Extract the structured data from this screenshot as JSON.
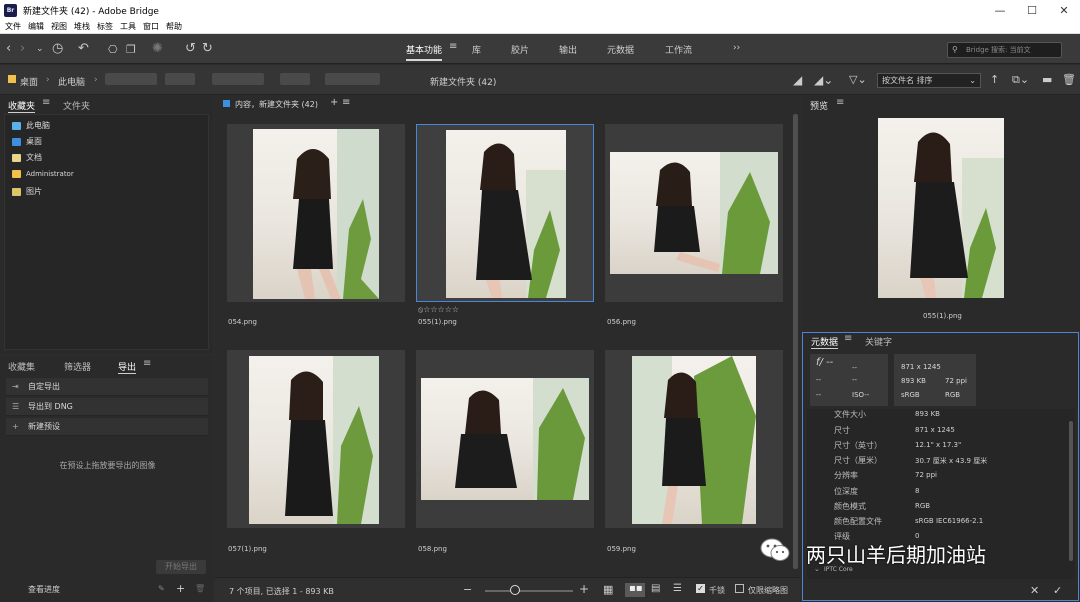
{
  "titlebar": {
    "logo": "Br",
    "title": "新建文件夹 (42) - Adobe Bridge",
    "minimize": "—",
    "maximize": "☐",
    "close": "✕"
  },
  "menu": [
    "文件",
    "编辑",
    "视图",
    "堆栈",
    "标签",
    "工具",
    "窗口",
    "帮助"
  ],
  "workspaces": [
    "基本功能",
    "库",
    "胶片",
    "输出",
    "元数据",
    "工作流"
  ],
  "workspace_more": "››",
  "search": {
    "placeholder": "Bridge 搜索: 当前文"
  },
  "path": {
    "items": [
      "桌面",
      "此电脑"
    ],
    "current_folder": "新建文件夹 (42)",
    "sort": "按文件名 排序"
  },
  "favorites": {
    "tab_active": "收藏夹",
    "tab_other": "文件夹",
    "items": [
      {
        "label": "此电脑",
        "icon": "computer-icon"
      },
      {
        "label": "桌面",
        "icon": "desktop-icon"
      },
      {
        "label": "文档",
        "icon": "document-icon"
      },
      {
        "label": "Administrator",
        "icon": "user-folder-icon"
      },
      {
        "label": "图片",
        "icon": "pictures-icon"
      }
    ]
  },
  "export_panel": {
    "tabs": [
      "收藏集",
      "筛选器",
      "导出"
    ],
    "rows": [
      "自定导出",
      "导出到 DNG",
      "新建预设"
    ],
    "hint": "在预设上拖放要导出的图像",
    "start_button": "开始导出",
    "progress_label": "查看进度"
  },
  "content": {
    "header": "内容，新建文件夹 (42)",
    "thumbnails": [
      {
        "name": "054.png",
        "orientation": "portrait",
        "selected": false
      },
      {
        "name": "055(1).png",
        "orientation": "portrait",
        "selected": true,
        "rating": "⦸☆☆☆☆☆"
      },
      {
        "name": "056.png",
        "orientation": "landscape",
        "selected": false
      },
      {
        "name": "057(1).png",
        "orientation": "portrait",
        "selected": false
      },
      {
        "name": "058.png",
        "orientation": "landscape",
        "selected": false
      },
      {
        "name": "059.png",
        "orientation": "portrait",
        "selected": false
      }
    ]
  },
  "preview": {
    "tab": "预览",
    "filename": "055(1).png"
  },
  "metadata": {
    "tab_active": "元数据",
    "tab_other": "关键字",
    "exif": {
      "f_stop": "f/ --",
      "dash1": "--",
      "dash2": "--",
      "dash3": "--",
      "dash4": "--",
      "iso": "ISO--",
      "dimensions": "871 x 1245",
      "size": "893 KB",
      "ppi": "72 ppi",
      "color1": "sRGB",
      "color2": "RGB"
    },
    "rows": [
      {
        "key": "文件大小",
        "value": "893 KB"
      },
      {
        "key": "尺寸",
        "value": "871 x 1245"
      },
      {
        "key": "尺寸（英寸）",
        "value": "12.1\" x 17.3\""
      },
      {
        "key": "尺寸（厘米）",
        "value": "30.7 厘米 x 43.9 厘米"
      },
      {
        "key": "分辨率",
        "value": "72 ppi"
      },
      {
        "key": "位深度",
        "value": "8"
      },
      {
        "key": "颜色模式",
        "value": "RGB"
      },
      {
        "key": "颜色配置文件",
        "value": "sRGB IEC61966-2.1"
      },
      {
        "key": "评级",
        "value": "0"
      }
    ],
    "section": "IPTC Core",
    "cancel": "✕",
    "apply": "✓"
  },
  "status": {
    "text": "7 个项目, 已选择 1 - 893 KB",
    "lock_label": "千锁",
    "thumbs_only": "仅限缩略图"
  },
  "watermark": "两只山羊后期加油站",
  "colors": {
    "accent": "#4a86d8",
    "folder": "#f0c14b",
    "desktop": "#3d8fe0"
  }
}
